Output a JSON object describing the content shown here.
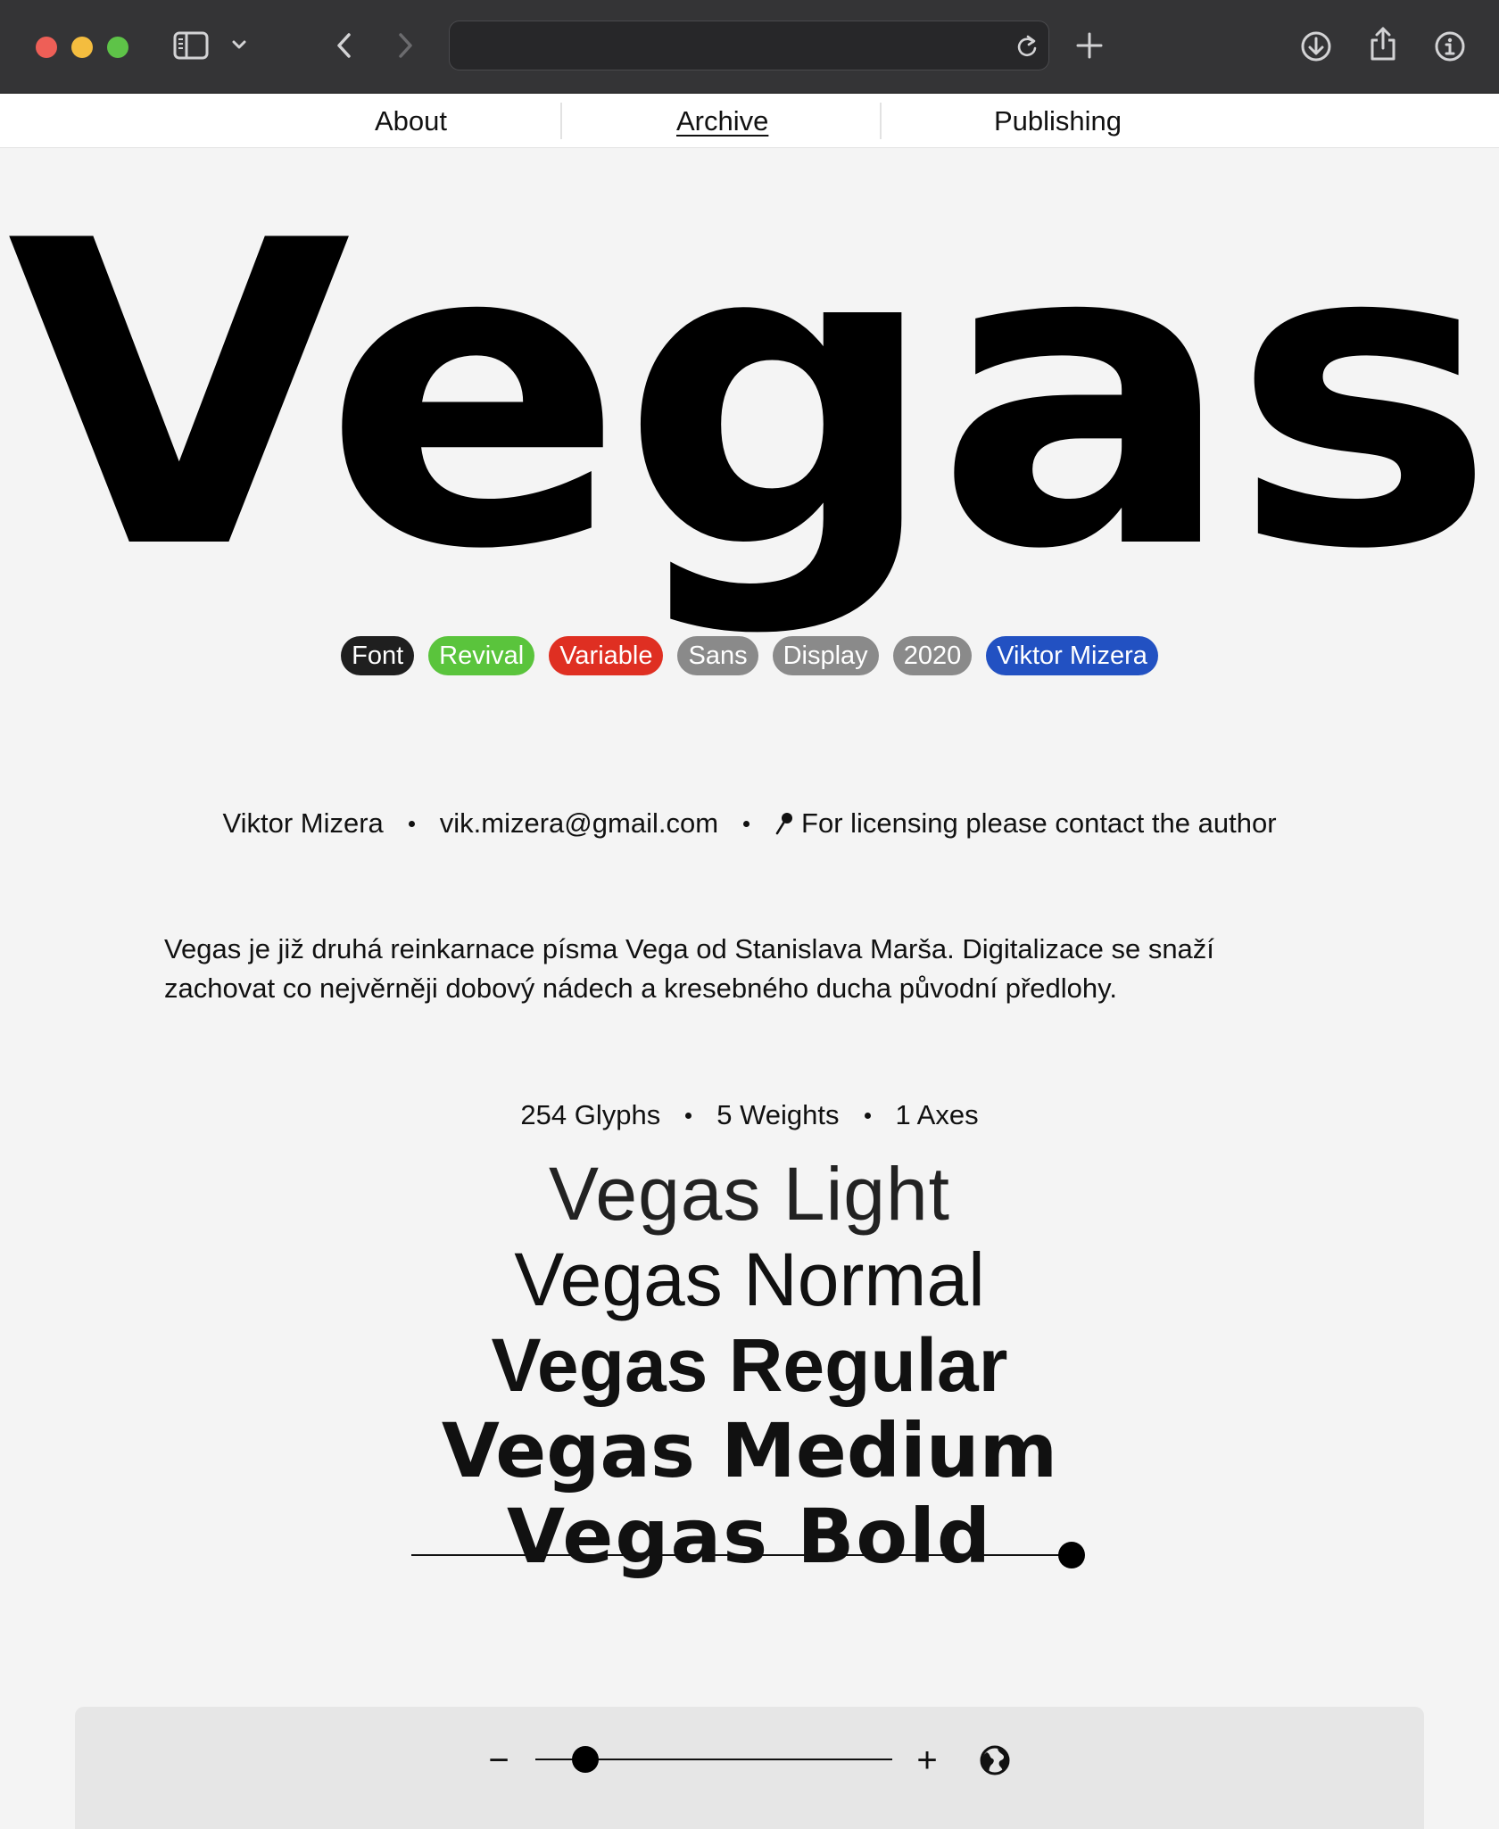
{
  "nav": {
    "about": "About",
    "archive": "Archive",
    "publishing": "Publishing"
  },
  "hero": {
    "title": "Vegas"
  },
  "tags": [
    {
      "label": "Font",
      "color": "#1f1f1f"
    },
    {
      "label": "Revival",
      "color": "#5ac43c"
    },
    {
      "label": "Variable",
      "color": "#df2f22"
    },
    {
      "label": "Sans",
      "color": "#8a8a8a"
    },
    {
      "label": "Display",
      "color": "#8a8a8a"
    },
    {
      "label": "2020",
      "color": "#8a8a8a"
    },
    {
      "label": "Viktor Mizera",
      "color": "#2251c2"
    }
  ],
  "meta": {
    "author": "Viktor Mizera",
    "email": "vik.mizera@gmail.com",
    "licensing": "For licensing please contact the author",
    "licensing_icon": "pin-icon"
  },
  "description": "Vegas je již druhá reinkarnace písma Vega od Stanislava Marša. Digitalizace se snaží zachovat co nejvěrněji dobový nádech a kresebného ducha původní předlohy.",
  "stats": {
    "glyphs": "254 Glyphs",
    "weights": "5 Weights",
    "axes": "1 Axes"
  },
  "weights": {
    "light": "Vegas Light",
    "normal": "Vegas Normal",
    "regular": "Vegas Regular",
    "medium": "Vegas Medium",
    "bold": "Vegas  Bold"
  },
  "weight_slider": {
    "value": 1.0
  },
  "size_controls": {
    "minus": "−",
    "plus": "+",
    "value": 0.14,
    "language_icon": "globe-icon"
  },
  "colors": {
    "page_background": "#f4f4f4",
    "chrome": "#343436"
  }
}
